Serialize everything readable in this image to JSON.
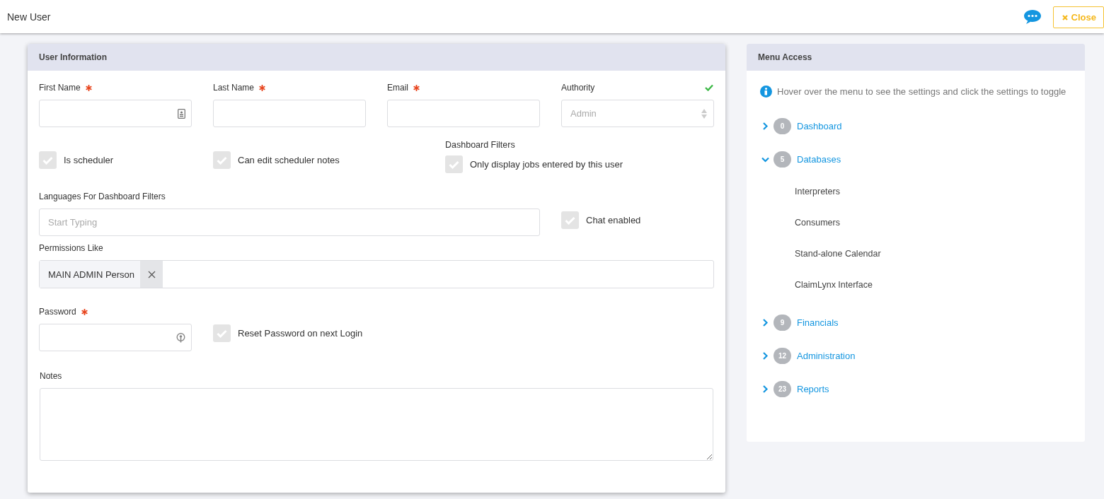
{
  "top_bar": {
    "title": "New User",
    "close_button": "Close"
  },
  "user_information": {
    "title": "User Information",
    "first_name": {
      "label": "First Name",
      "required": true
    },
    "last_name": {
      "label": "Last Name",
      "required": true
    },
    "email": {
      "label": "Email",
      "required": true
    },
    "authority": {
      "label": "Authority",
      "valid": true,
      "value": "Admin",
      "disabled": true
    },
    "is_scheduler": {
      "label": "Is scheduler",
      "checked": false
    },
    "can_edit_scheduler_notes": {
      "label": "Can edit scheduler notes",
      "checked": false
    },
    "dashboard_filters": {
      "title": "Dashboard Filters",
      "only_own_jobs": {
        "label": "Only display jobs entered by this user",
        "checked": false
      }
    },
    "languages": {
      "label": "Languages For Dashboard Filters",
      "placeholder": "Start Typing"
    },
    "chat_enabled": {
      "label": "Chat enabled",
      "checked": false
    },
    "permissions_like": {
      "label": "Permissions Like",
      "tags": [
        "MAIN ADMIN Person"
      ]
    },
    "password": {
      "label": "Password",
      "required": true
    },
    "reset_password": {
      "label": "Reset Password on next Login",
      "checked": false
    },
    "notes": {
      "label": "Notes"
    }
  },
  "menu_access": {
    "title": "Menu Access",
    "hint": "Hover over the menu to see the settings and click the settings to toggle",
    "items": [
      {
        "label": "Dashboard",
        "count": "0",
        "expanded": false
      },
      {
        "label": "Databases",
        "count": "5",
        "expanded": true,
        "children": [
          {
            "label": "Interpreters"
          },
          {
            "label": "Consumers"
          },
          {
            "label": "Stand-alone Calendar"
          },
          {
            "label": "ClaimLynx Interface"
          }
        ]
      },
      {
        "label": "Financials",
        "count": "9",
        "expanded": false
      },
      {
        "label": "Administration",
        "count": "12",
        "expanded": false
      },
      {
        "label": "Reports",
        "count": "23",
        "expanded": false
      }
    ]
  }
}
